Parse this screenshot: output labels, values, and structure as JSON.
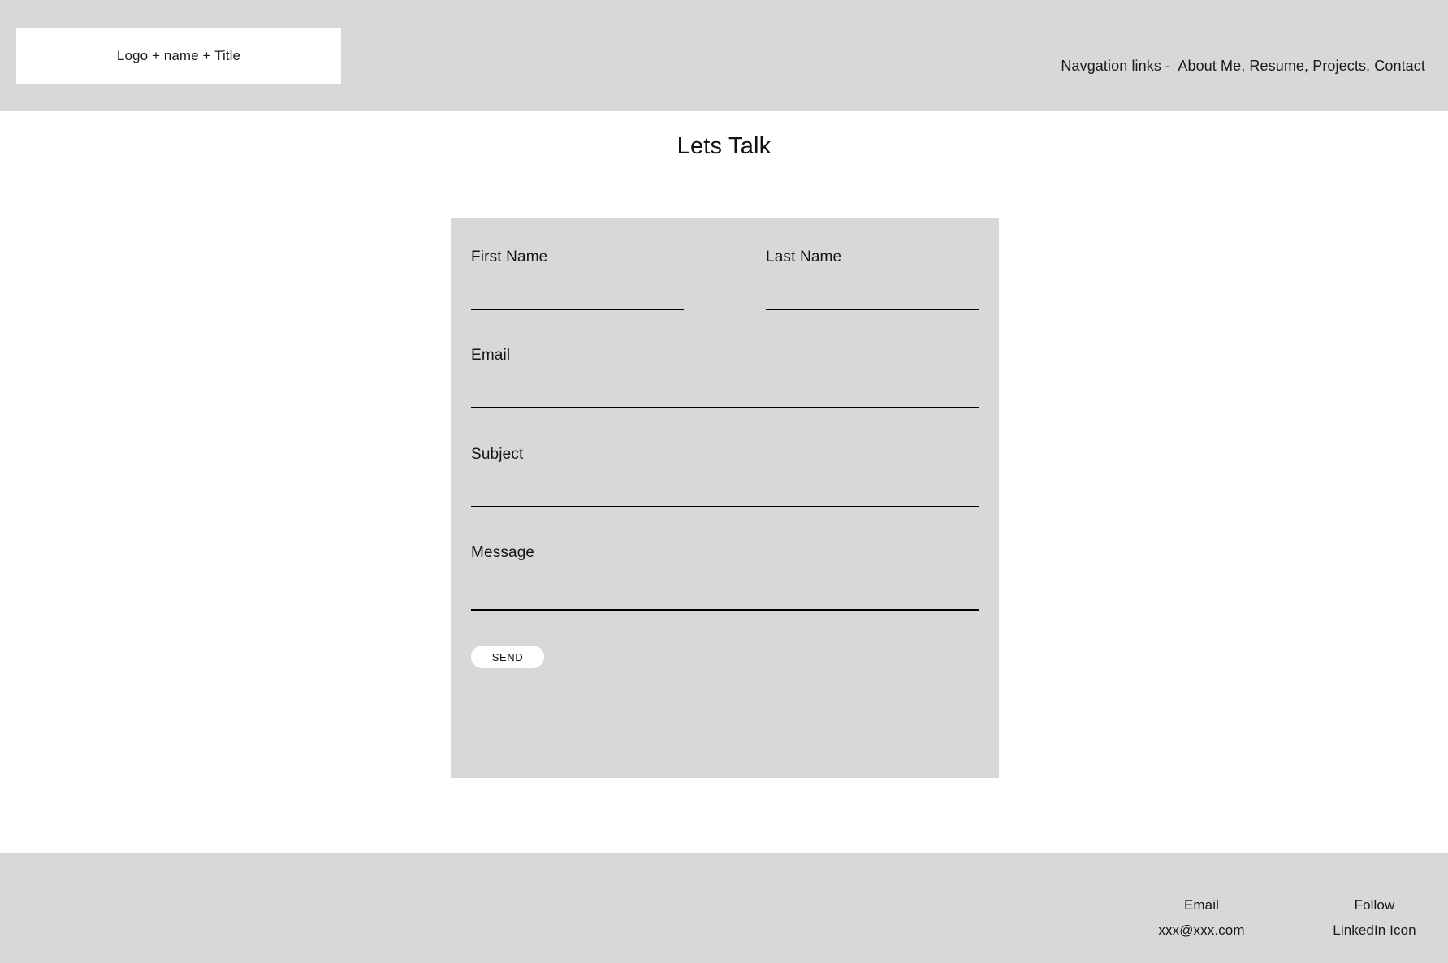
{
  "header": {
    "logo_box_label": "Logo + name + Title",
    "nav_text": "Navgation links -  About Me, Resume, Projects, Contact",
    "nav_prefix": "Navgation links -",
    "nav_items": [
      "About Me",
      "Resume",
      "Projects",
      "Contact"
    ],
    "background_color": "#d8d8d8",
    "logo_box_color": "#ffffff"
  },
  "main": {
    "title": "Lets Talk",
    "card_background_color": "#d8d8d8",
    "page_background_color": "#ffffff",
    "form": {
      "fields": [
        {
          "label": "First Name",
          "value": "",
          "placeholder": ""
        },
        {
          "label": "Last Name",
          "value": "",
          "placeholder": ""
        },
        {
          "label": "Email",
          "value": "",
          "placeholder": ""
        },
        {
          "label": "Subject",
          "value": "",
          "placeholder": ""
        },
        {
          "label": "Message",
          "value": "",
          "placeholder": ""
        }
      ],
      "submit_label": "SEND",
      "submit_background_color": "#ffffff"
    }
  },
  "footer": {
    "background_color": "#d8d8d8",
    "columns": [
      {
        "title": "Email",
        "value": "xxx@xxx.com"
      },
      {
        "title": "Follow",
        "value": "LinkedIn Icon"
      }
    ]
  }
}
